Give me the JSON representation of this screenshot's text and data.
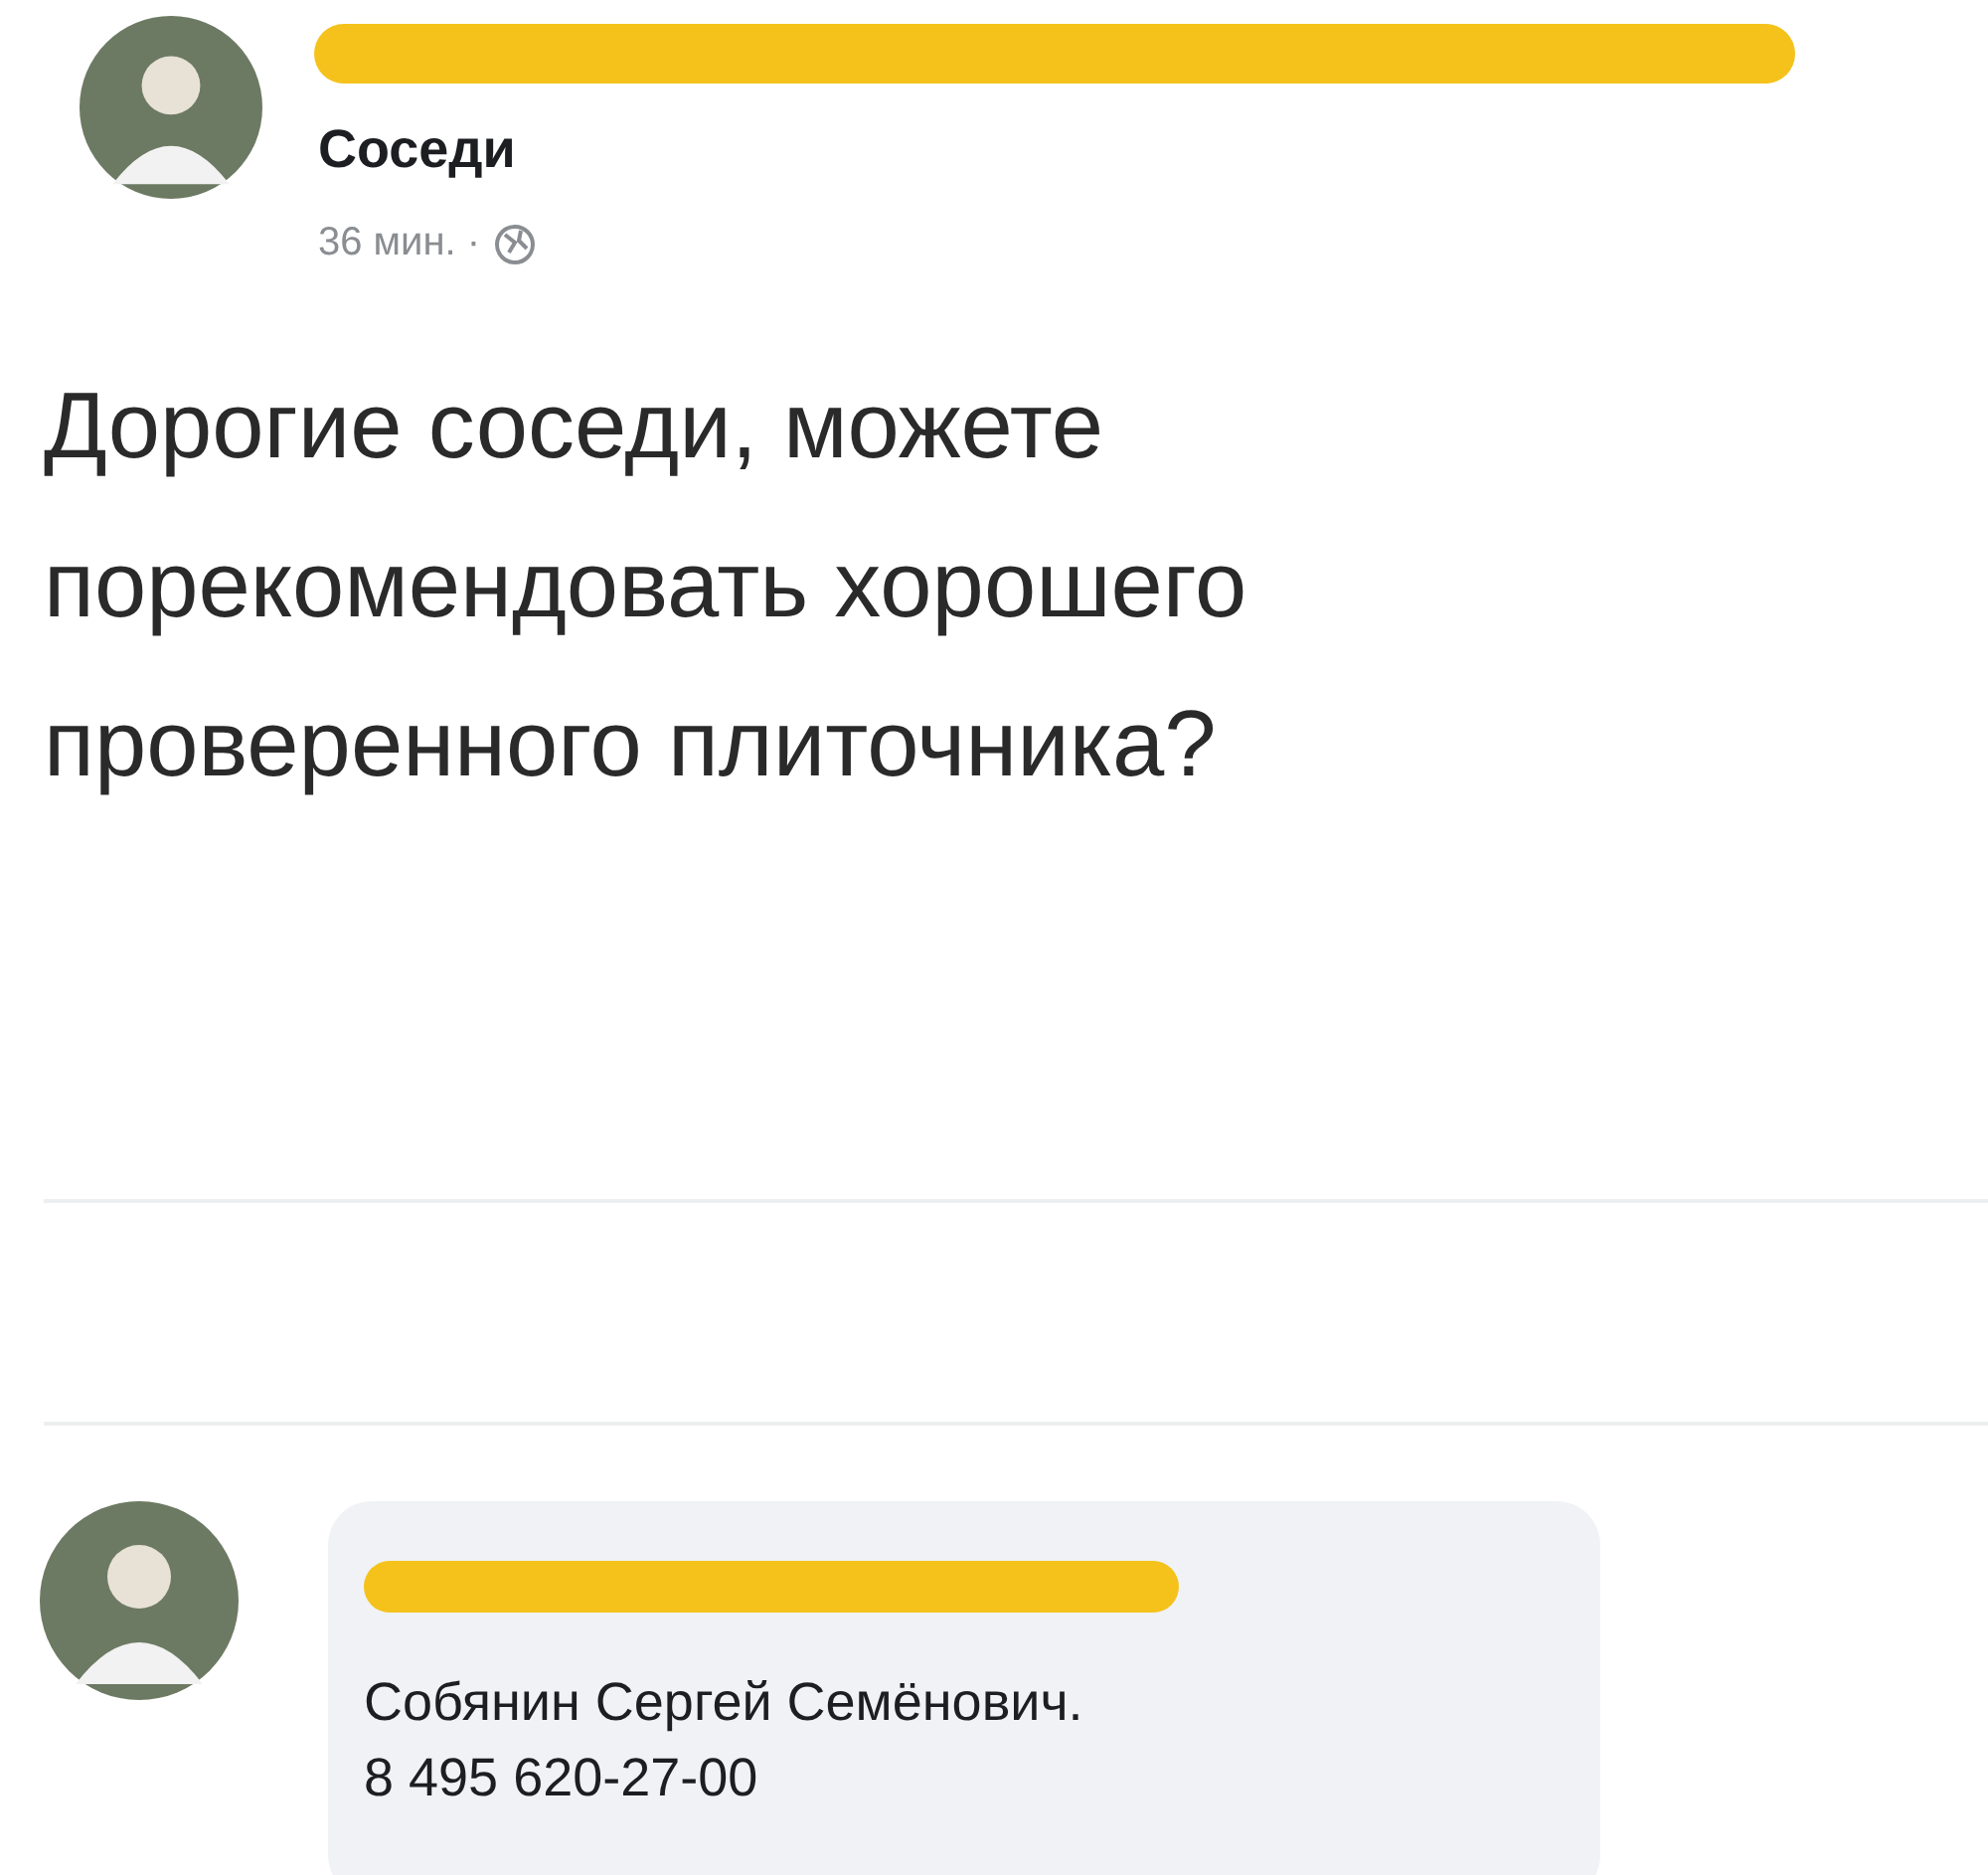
{
  "post": {
    "author": "Соседи",
    "time": "36 мин. ·",
    "text": [
      "Дорогие соседи, можете",
      "порекомендовать хорошего",
      "проверенного плиточника?"
    ]
  },
  "comment": {
    "lines": [
      "Собянин Сергей Семёнович.",
      "8 495 620-27-00"
    ]
  }
}
